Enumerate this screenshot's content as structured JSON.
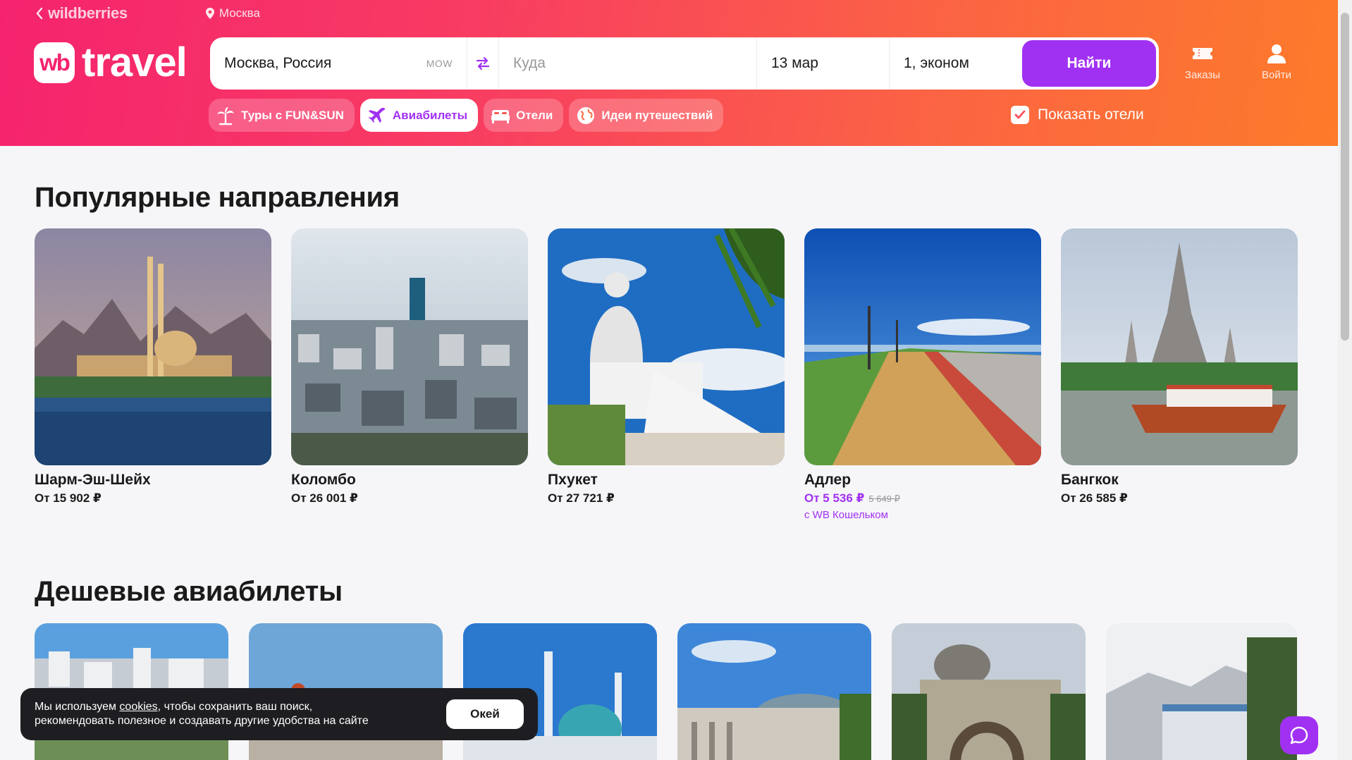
{
  "topbar": {
    "back_label": "wildberries",
    "location": "Москва"
  },
  "logo": {
    "badge": "wb",
    "text": "travel"
  },
  "search": {
    "from_value": "Москва, Россия",
    "from_code": "MOW",
    "to_placeholder": "Куда",
    "date_value": "13 мар",
    "passengers_value": "1, эконом",
    "find_label": "Найти"
  },
  "header_actions": {
    "orders_label": "Заказы",
    "login_label": "Войти"
  },
  "chips": [
    {
      "label": "Туры с FUN&SUN",
      "icon": "palm-icon"
    },
    {
      "label": "Авиабилеты",
      "icon": "plane-icon"
    },
    {
      "label": "Отели",
      "icon": "bed-icon"
    },
    {
      "label": "Идеи путешествий",
      "icon": "globe-icon"
    }
  ],
  "show_hotels_label": "Показать отели",
  "popular": {
    "title": "Популярные направления",
    "items": [
      {
        "name": "Шарм-Эш-Шейх",
        "price": "От 15 902 ₽"
      },
      {
        "name": "Коломбо",
        "price": "От 26 001 ₽"
      },
      {
        "name": "Пхукет",
        "price": "От 27 721 ₽"
      },
      {
        "name": "Адлер",
        "price": "От 5 536 ₽",
        "old_price": "5 649 ₽",
        "wallet_note": "с WB Кошельком"
      },
      {
        "name": "Бангкок",
        "price": "От 26 585 ₽"
      }
    ]
  },
  "cheap": {
    "title": "Дешевые авиабилеты"
  },
  "cookie": {
    "text_before": "Мы используем ",
    "link": "cookies",
    "text_after": ", чтобы сохранить ваш поиск,",
    "line2": "рекомендовать полезное и создавать другие удобства на сайте",
    "ok_label": "Окей"
  },
  "colors": {
    "accent": "#a131f2",
    "header_start": "#f5236e",
    "header_end": "#fd7b2a"
  }
}
